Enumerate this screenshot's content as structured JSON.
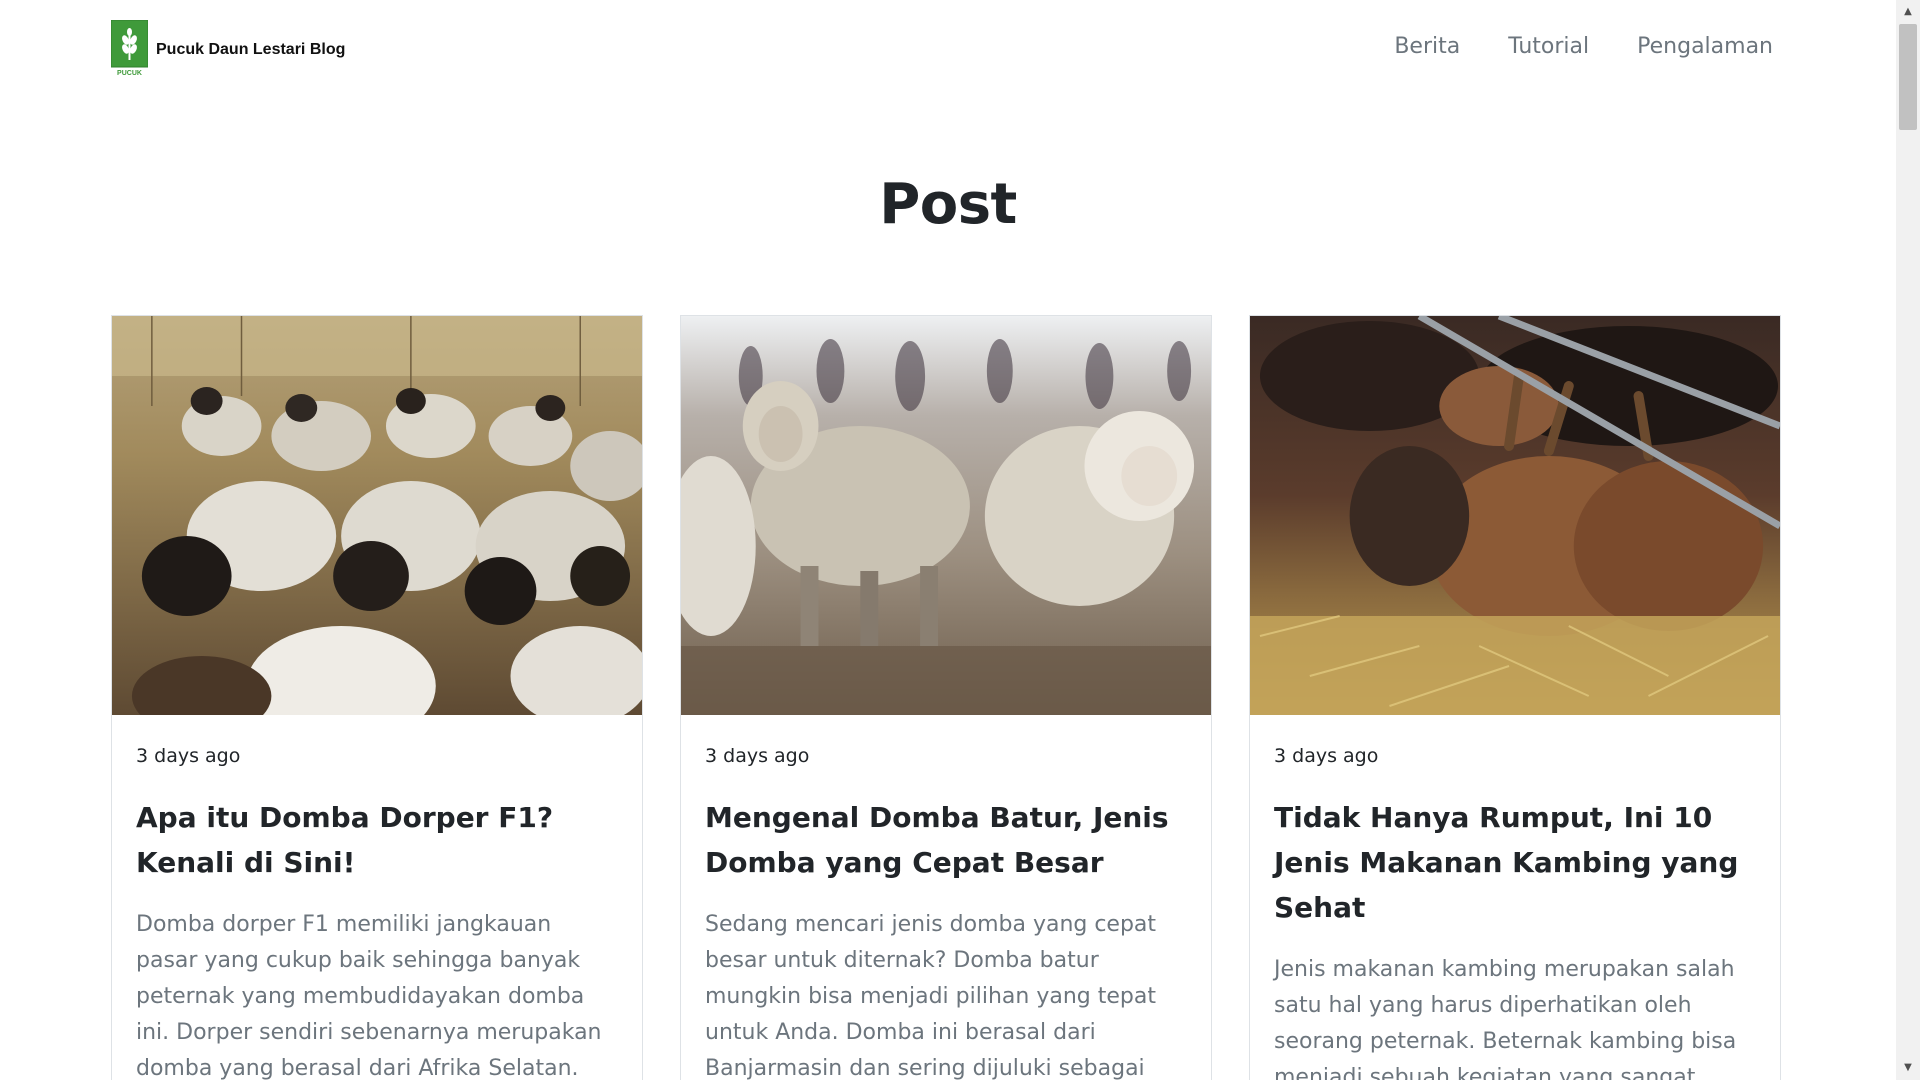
{
  "header": {
    "brand_name": "Pucuk Daun Lestari Blog",
    "logo_caption": "PUCUK",
    "nav": [
      {
        "label": "Berita"
      },
      {
        "label": "Tutorial"
      },
      {
        "label": "Pengalaman"
      }
    ]
  },
  "main": {
    "title": "Post",
    "posts": [
      {
        "date": "3 days ago",
        "title": "Apa itu Domba Dorper F1? Kenali di Sini!",
        "excerpt": "Domba dorper F1 memiliki jangkauan pasar yang cukup baik sehingga banyak peternak yang membudidayakan domba ini. Dorper sendiri sebenarnya merupakan domba yang berasal dari Afrika Selatan. Sejak tahun",
        "image": "sheep-flock-photo"
      },
      {
        "date": "3 days ago",
        "title": "Mengenal Domba Batur, Jenis Domba yang Cepat Besar",
        "excerpt": "Sedang mencari jenis domba yang cepat besar untuk diternak? Domba batur mungkin bisa menjadi pilihan yang tepat untuk Anda. Domba ini berasal dari Banjarmasin dan sering dijuluki sebagai shaun the she",
        "image": "lambs-photo"
      },
      {
        "date": "3 days ago",
        "title": "Tidak Hanya Rumput, Ini 10 Jenis Makanan Kambing yang Sehat",
        "excerpt": "Jenis makanan kambing merupakan salah satu hal yang harus diperhatikan oleh seorang peternak. Beternak kambing bisa menjadi sebuah kegiatan yang sangat menguntungkan. Pasalnya, hingga saat ini",
        "image": "goats-eating-hay-photo"
      }
    ]
  },
  "colors": {
    "logo_green": "#3f9a3a",
    "nav_text": "#6c757d",
    "heading": "#212529",
    "excerpt": "#6c757d",
    "card_border": "#dee2e6"
  }
}
